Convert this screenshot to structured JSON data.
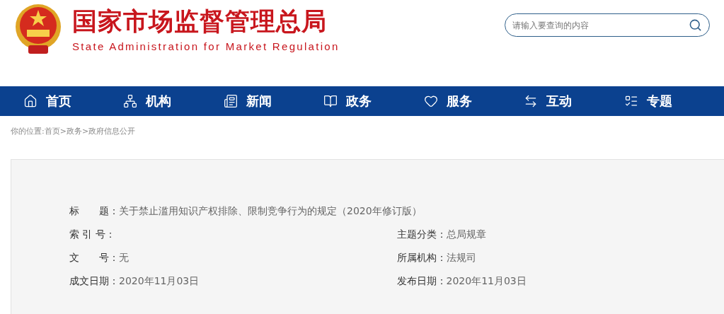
{
  "header": {
    "title": "国家市场监督管理总局",
    "subtitle": "State Administration for Market Regulation",
    "search": {
      "placeholder": "请输入要查询的内容"
    }
  },
  "nav": [
    {
      "label": "首页"
    },
    {
      "label": "机构"
    },
    {
      "label": "新闻"
    },
    {
      "label": "政务"
    },
    {
      "label": "服务"
    },
    {
      "label": "互动"
    },
    {
      "label": "专题"
    }
  ],
  "breadcrumb": "你的位置:首页>政务>政府信息公开",
  "meta": {
    "title": {
      "label": "标　　题：",
      "value": "关于禁止滥用知识产权排除、限制竞争行为的规定（2020年修订版）"
    },
    "rows": [
      [
        {
          "label": "索 引 号："
        },
        {
          "label": "主题分类：",
          "value": "总局规章"
        }
      ],
      [
        {
          "label": "文　　号：",
          "value": "无"
        },
        {
          "label": "所属机构：",
          "value": "法规司"
        }
      ],
      [
        {
          "label": "成文日期：",
          "value": "2020年11月03日"
        },
        {
          "label": "发布日期：",
          "value": "2020年11月03日"
        }
      ]
    ]
  }
}
